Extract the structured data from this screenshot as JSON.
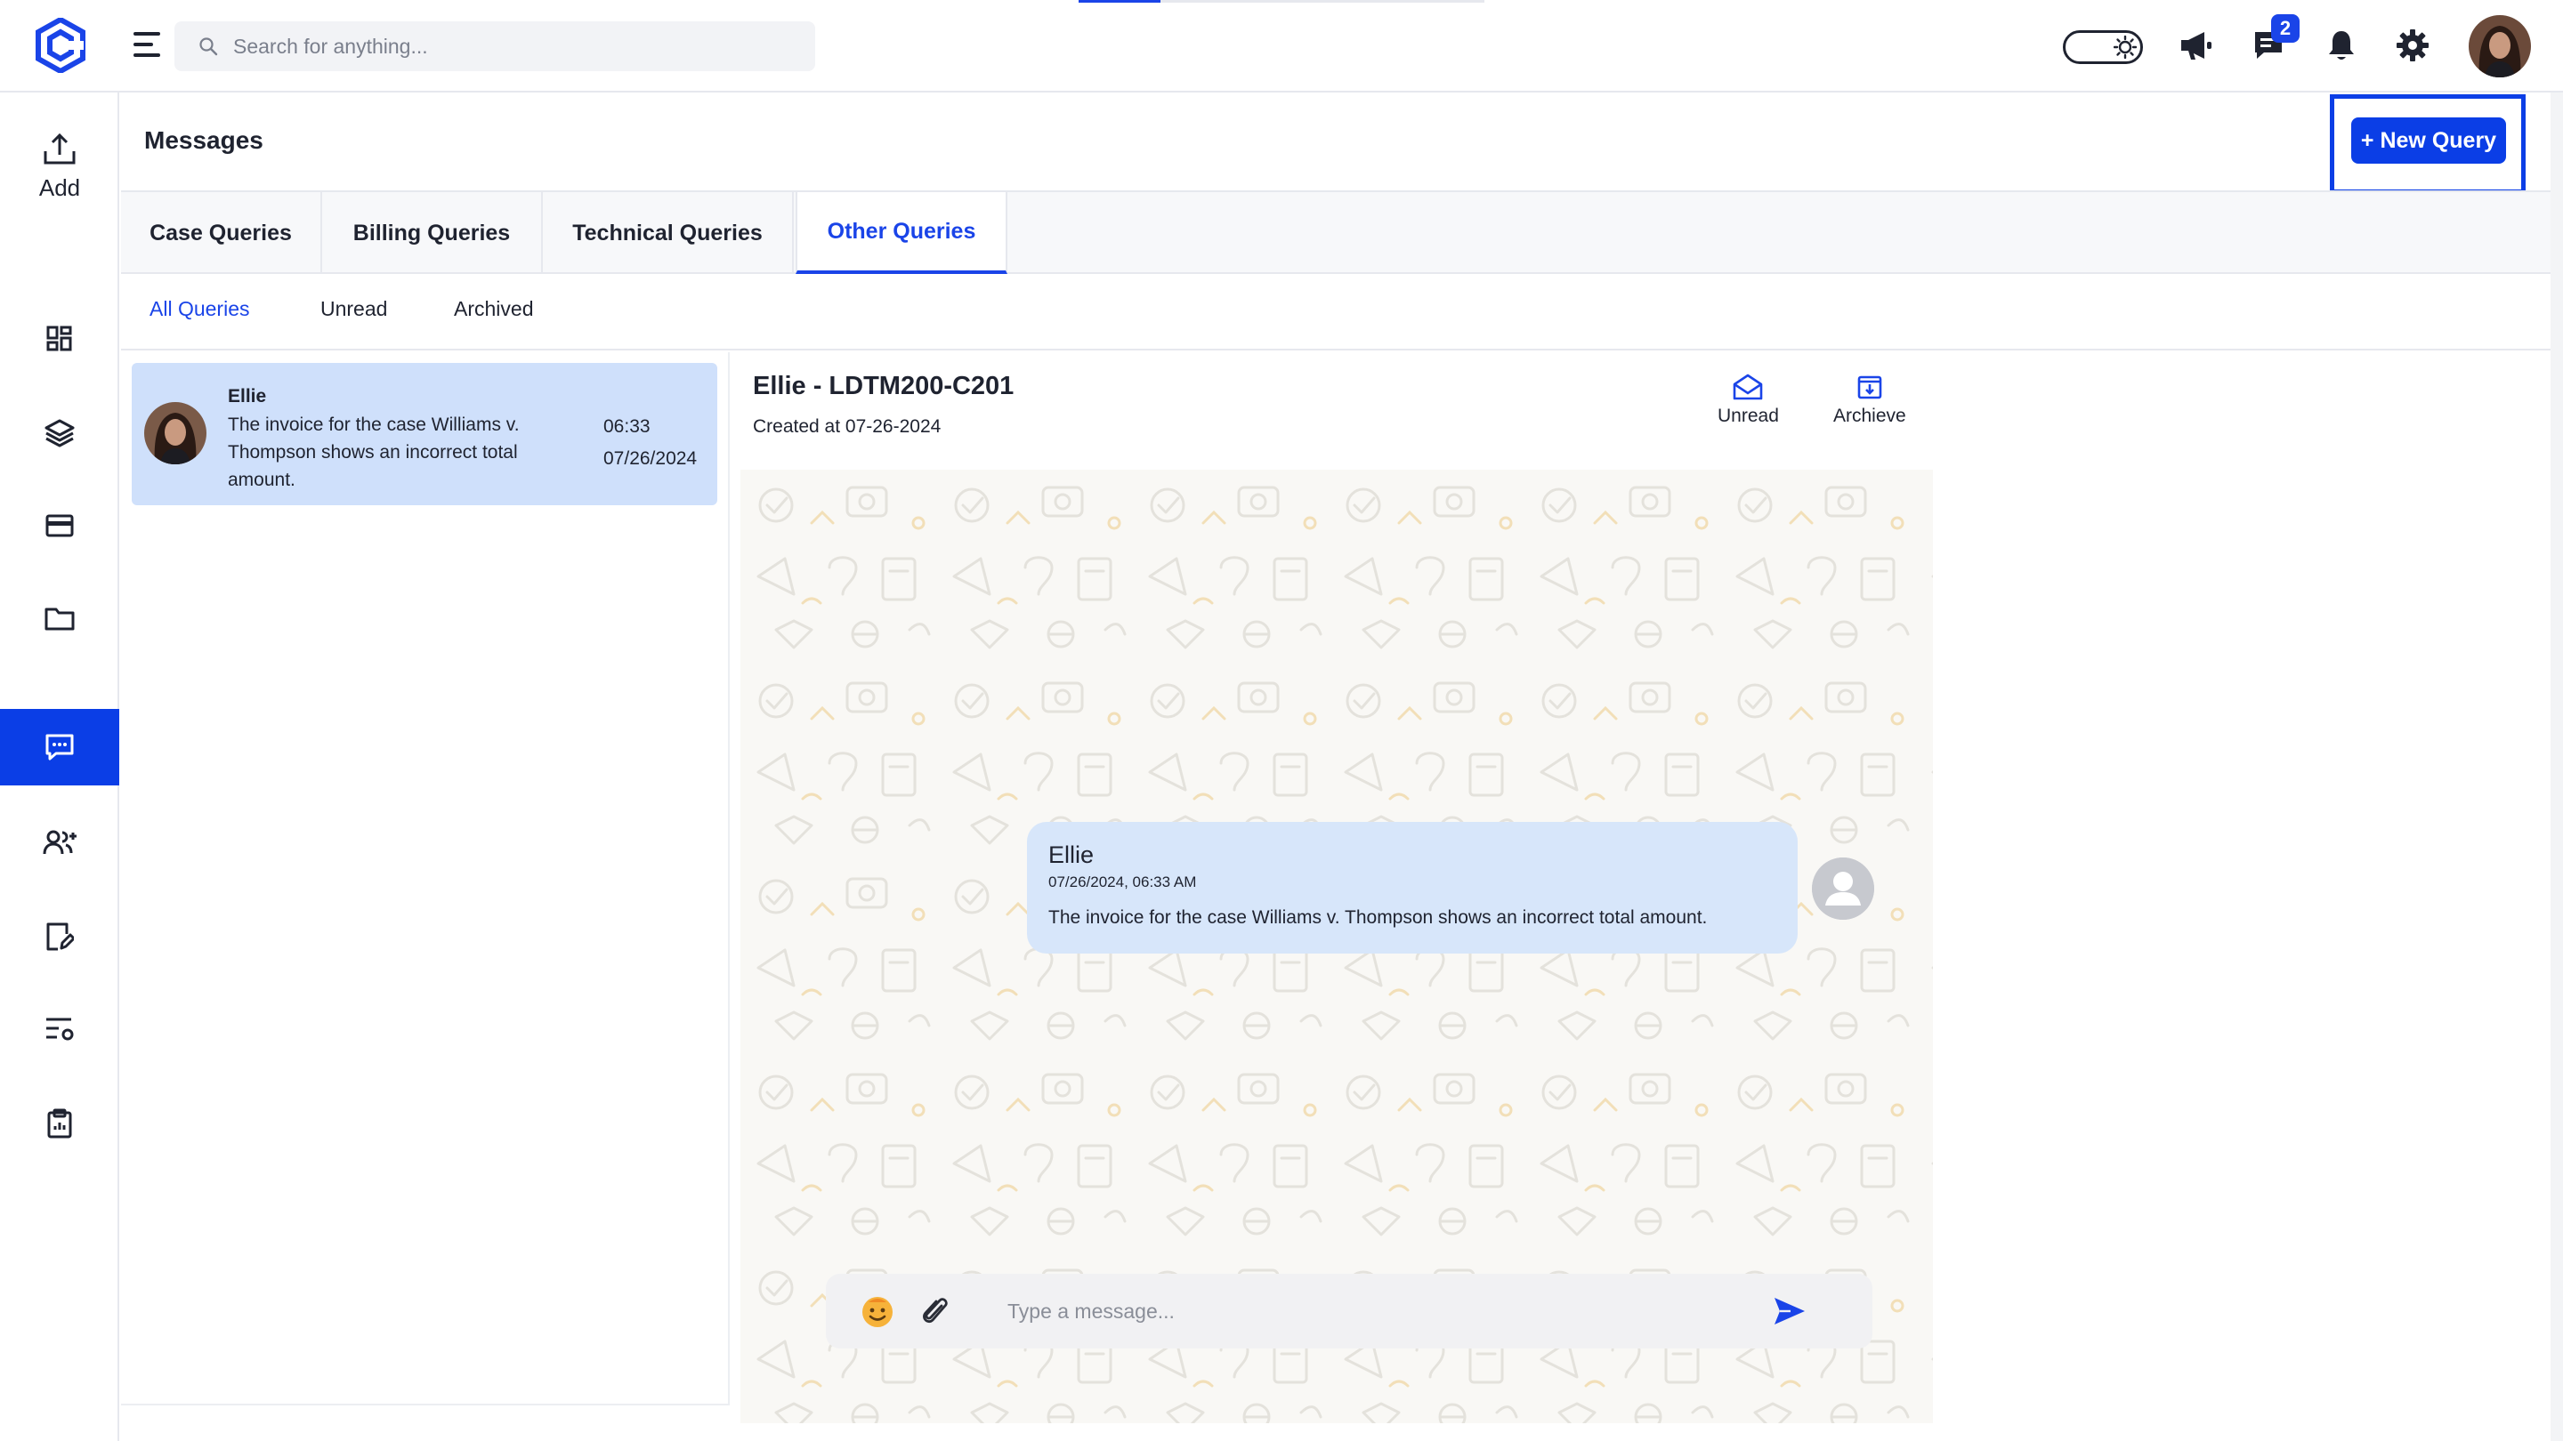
{
  "search": {
    "placeholder": "Search for anything..."
  },
  "header": {
    "notifications_badge": "2"
  },
  "sidebar": {
    "add_label": "Add",
    "items": [
      {
        "icon": "dashboard-icon"
      },
      {
        "icon": "layers-icon"
      },
      {
        "icon": "card-icon"
      },
      {
        "icon": "folder-icon"
      },
      {
        "icon": "message-icon",
        "active": true
      },
      {
        "icon": "users-icon"
      },
      {
        "icon": "edit-document-icon"
      },
      {
        "icon": "list-settings-icon"
      },
      {
        "icon": "clipboard-icon"
      }
    ]
  },
  "page": {
    "title": "Messages",
    "new_query_label": "+ New Query"
  },
  "tabs": [
    {
      "label": "Case Queries"
    },
    {
      "label": "Billing Queries"
    },
    {
      "label": "Technical Queries"
    },
    {
      "label": "Other Queries",
      "active": true
    }
  ],
  "subtabs": [
    {
      "label": "All Queries",
      "active": true
    },
    {
      "label": "Unread"
    },
    {
      "label": "Archived"
    }
  ],
  "conversations": [
    {
      "name": "Ellie",
      "preview": "The invoice for the case Williams v. Thompson shows an incorrect total amount.",
      "time": "06:33",
      "date": "07/26/2024"
    }
  ],
  "chat": {
    "title": "Ellie - LDTM200-C201",
    "created": "Created at 07-26-2024",
    "actions": {
      "unread_label": "Unread",
      "archive_label": "Archieve"
    },
    "messages": [
      {
        "sender": "Ellie",
        "timestamp": "07/26/2024, 06:33 AM",
        "text": "The invoice for the case Williams v. Thompson shows an incorrect total amount."
      }
    ],
    "composer_placeholder": "Type a message..."
  },
  "colors": {
    "accent": "#0b3ee6",
    "selected_conversation": "#cfe0fb",
    "bubble": "#d7e6fa"
  }
}
